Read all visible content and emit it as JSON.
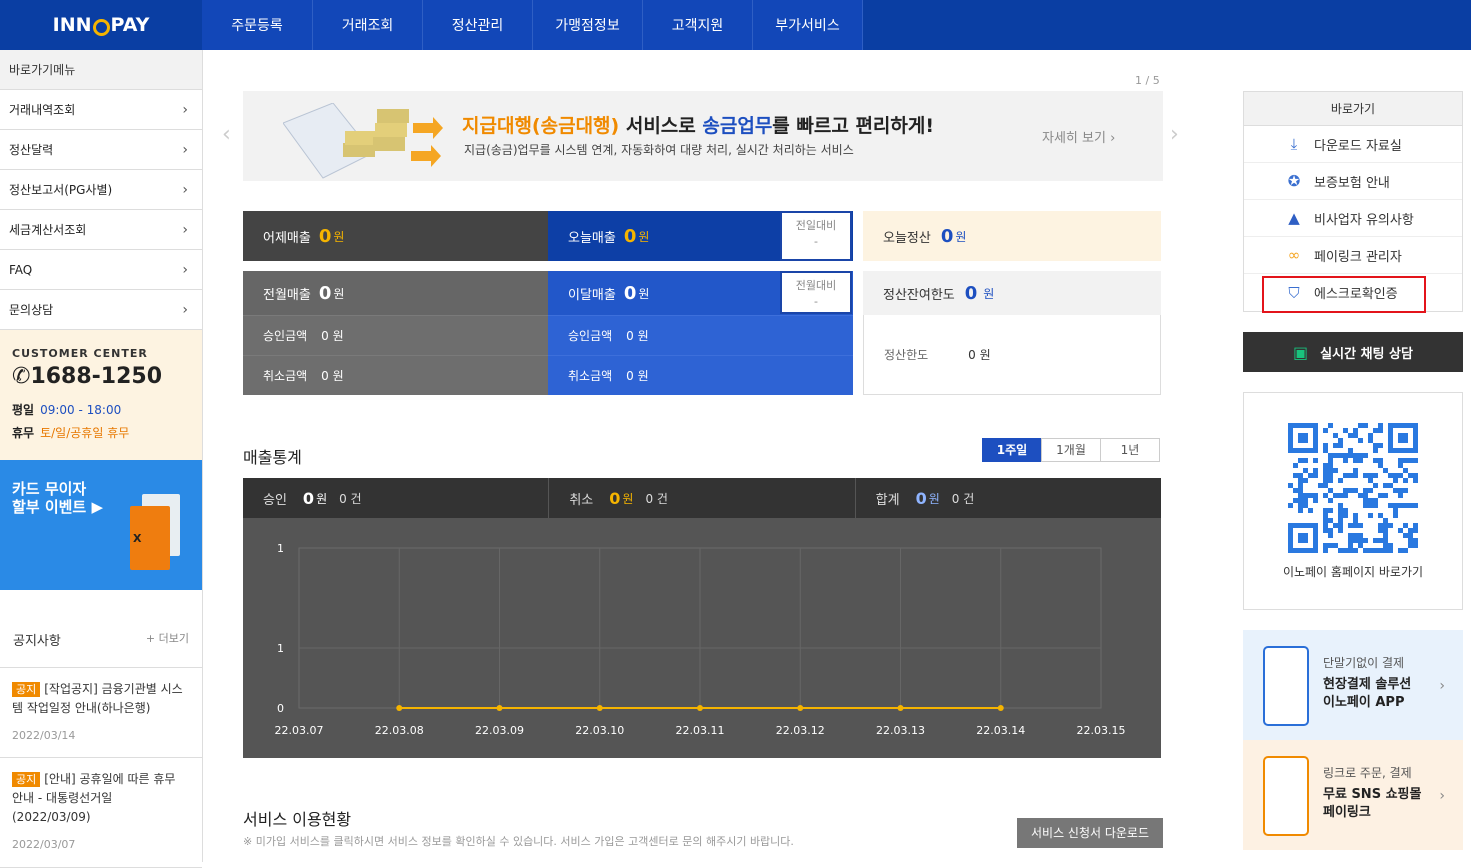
{
  "logo": {
    "left": "INN",
    "right": "PAY"
  },
  "nav": [
    "주문등록",
    "거래조회",
    "정산관리",
    "가맹점정보",
    "고객지원",
    "부가서비스"
  ],
  "sidebar": {
    "title": "바로가기메뉴",
    "items": [
      "거래내역조회",
      "정산달력",
      "정산보고서(PG사별)",
      "세금계산서조회",
      "FAQ",
      "문의상담"
    ],
    "customer_center": {
      "title": "CUSTOMER CENTER",
      "phone": "1688-1250",
      "weekday_label": "평일",
      "weekday_hours": "09:00 - 18:00",
      "holiday_label": "휴무",
      "holiday_text": "토/일/공휴일 휴무"
    },
    "event": {
      "line1": "카드 무이자",
      "line2": "할부 이벤트 ▶",
      "card_mark": "X"
    },
    "notice": {
      "title": "공지사항",
      "more": "+ 더보기",
      "items": [
        {
          "tag": "공지",
          "text": "[작업공지] 금융기관별 시스템 작업일정 안내(하나은행)",
          "date": "2022/03/14"
        },
        {
          "tag": "공지",
          "text": "[안내] 공휴일에 따른 휴무 안내 - 대통령선거일 (2022/03/09)",
          "date": "2022/03/07"
        }
      ]
    }
  },
  "banner": {
    "pager": "1 / 5",
    "headline_part1": "지급대행(송금대행)",
    "headline_part2": " 서비스로 ",
    "headline_part3": "송금업무",
    "headline_part4": "를 빠르고 편리하게!",
    "subtitle": "지급(송금)업무를 시스템 연계, 자동화하여 대량 처리, 실시간 처리하는 서비스",
    "more": "자세히 보기 ›"
  },
  "sales": {
    "yesterday_label": "어제매출",
    "yesterday_value": "0",
    "unit": "원",
    "today_label": "오늘매출",
    "today_value": "0",
    "compare_daily": "전일대비",
    "compare_daily_value": "-",
    "last_month_label": "전월매출",
    "last_month_value": "0",
    "this_month_label": "이달매출",
    "this_month_value": "0",
    "compare_monthly": "전월대비",
    "compare_monthly_value": "-",
    "approve_label": "승인금액",
    "approve_value": "0 원",
    "cancel_label": "취소금액",
    "cancel_value": "0 원",
    "approve_value2": "0 원",
    "cancel_value2": "0 원",
    "settle_today_label": "오늘정산",
    "settle_today_value": "0",
    "settle_remain_label": "정산잔여한도",
    "settle_remain_value": "0",
    "settle_limit_label": "정산한도",
    "settle_limit_value": "0 원"
  },
  "stats": {
    "title": "매출통계",
    "tabs": [
      "1주일",
      "1개월",
      "1년"
    ],
    "approve_label": "승인",
    "approve_value": "0",
    "approve_count": "0 건",
    "cancel_label": "취소",
    "cancel_value": "0",
    "cancel_count": "0 건",
    "total_label": "합계",
    "total_value": "0",
    "total_count": "0 건",
    "unit": "원"
  },
  "chart_data": {
    "type": "line",
    "x": [
      "22.03.07",
      "22.03.08",
      "22.03.09",
      "22.03.10",
      "22.03.11",
      "22.03.12",
      "22.03.13",
      "22.03.14",
      "22.03.15"
    ],
    "series": [
      {
        "values": [
          null,
          0,
          0,
          0,
          0,
          0,
          0,
          0,
          null
        ]
      }
    ],
    "y_ticks": [
      "1",
      "1",
      "0"
    ],
    "ylim": [
      0,
      1
    ],
    "grid": true,
    "line_color": "#f5b400"
  },
  "services": {
    "title": "서비스 이용현황",
    "note": "※ 미가입 서비스를 클릭하시면 서비스 정보를 확인하실 수 있습니다. 서비스 가입은 고객센터로 문의 해주시기 바랍니다.",
    "download": "서비스 신청서 다운로드"
  },
  "quick": {
    "title": "바로가기",
    "items": [
      {
        "label": "다운로드 자료실",
        "icon": "download-icon"
      },
      {
        "label": "보증보험 안내",
        "icon": "badge-icon"
      },
      {
        "label": "비사업자 유의사항",
        "icon": "warning-icon"
      },
      {
        "label": "페이링크 관리자",
        "icon": "link-icon"
      },
      {
        "label": "에스크로확인증",
        "icon": "shield-icon"
      }
    ]
  },
  "chat": {
    "label": "실시간 채팅 상담"
  },
  "qr": {
    "caption": "이노페이 홈페이지 바로가기"
  },
  "promos": [
    {
      "small": "단말기없이 결제",
      "line1": "현장결제 솔루션",
      "line2": "이노페이 APP"
    },
    {
      "small": "링크로 주문, 결제",
      "line1": "무료 SNS 쇼핑몰",
      "line2": "페이링크"
    }
  ],
  "colors": {
    "primary": "#0a3ea3",
    "accent": "#f5b400",
    "orange": "#f08a00"
  }
}
